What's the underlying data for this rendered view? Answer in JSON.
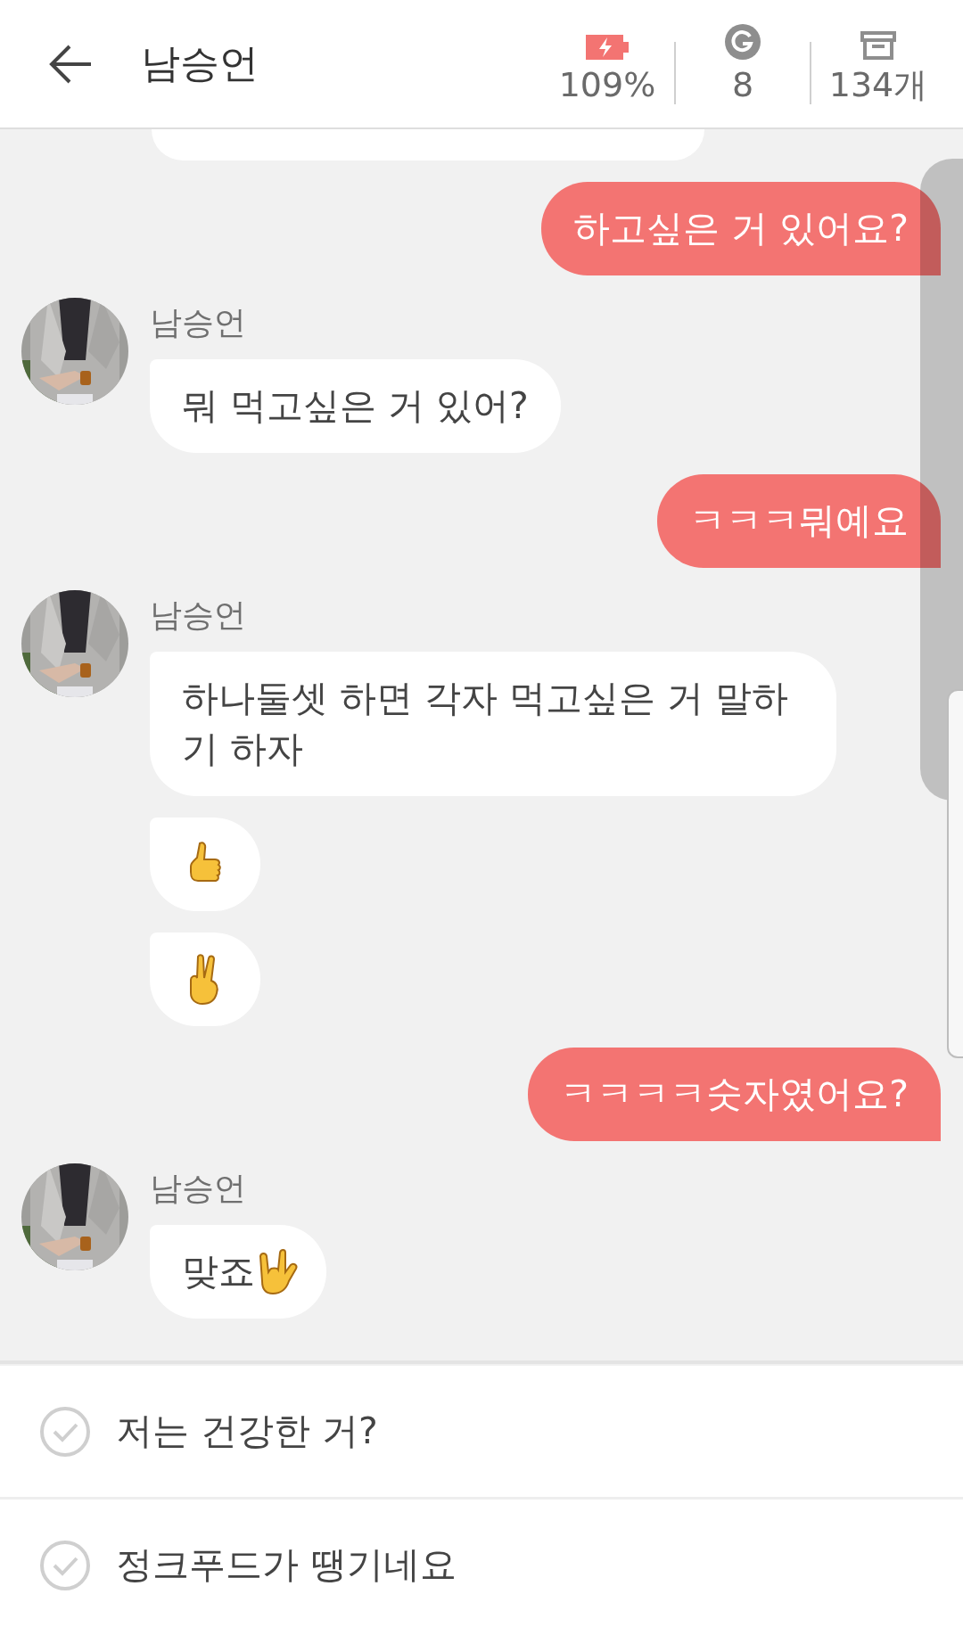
{
  "header": {
    "title": "남승언",
    "stats": [
      {
        "kind": "battery",
        "value": "109%"
      },
      {
        "kind": "points",
        "value": "8"
      },
      {
        "kind": "archive",
        "value": "134개"
      }
    ]
  },
  "messages": [
    {
      "kind": "partial"
    },
    {
      "kind": "sent",
      "text": "하고싶은 거 있어요?"
    },
    {
      "kind": "received",
      "sender": "남승언",
      "text": "뭐 먹고싶은 거 있어?"
    },
    {
      "kind": "sent",
      "text": "ㅋㅋㅋ뭐예요"
    },
    {
      "kind": "received",
      "sender": "남승언",
      "text": "하나둘셋 하면 각자 먹고싶은 거 말하기 하자"
    },
    {
      "kind": "thumbs"
    },
    {
      "kind": "victory"
    },
    {
      "kind": "sent",
      "text": "ㅋㅋㅋㅋ숫자였어요?"
    },
    {
      "kind": "horns",
      "sender": "남승언",
      "text": "맞죠"
    }
  ],
  "reply_options": [
    {
      "text": "저는 건강한 거?",
      "checked": false
    },
    {
      "text": "정크푸드가 땡기네요",
      "checked": false
    }
  ]
}
